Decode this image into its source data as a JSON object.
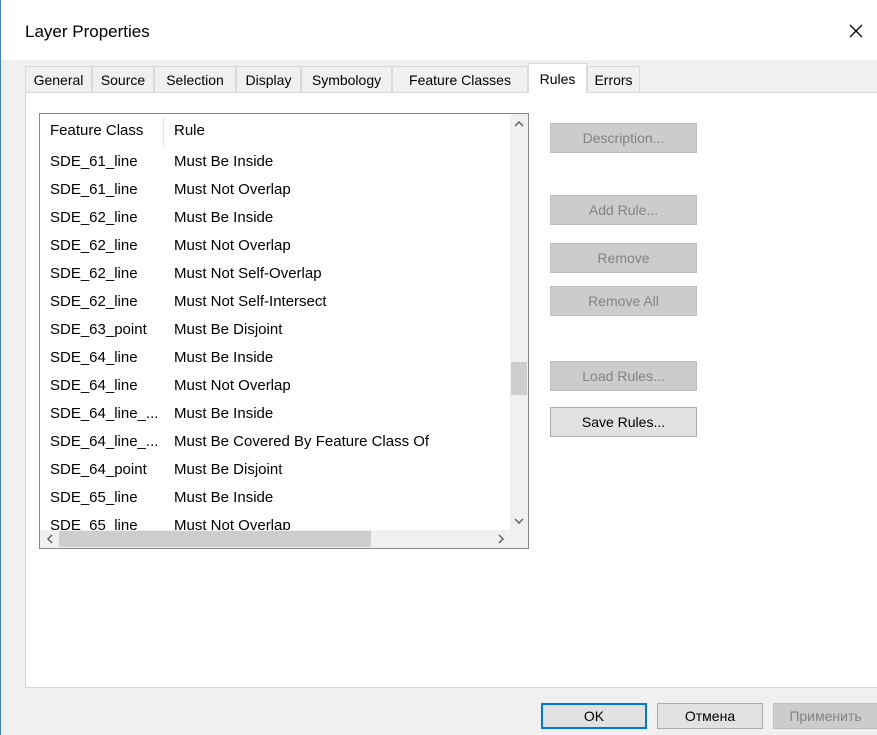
{
  "window": {
    "title": "Layer Properties"
  },
  "tabs": [
    {
      "label": "General",
      "active": false
    },
    {
      "label": "Source",
      "active": false
    },
    {
      "label": "Selection",
      "active": false
    },
    {
      "label": "Display",
      "active": false
    },
    {
      "label": "Symbology",
      "active": false
    },
    {
      "label": "Feature Classes",
      "active": false
    },
    {
      "label": "Rules",
      "active": true
    },
    {
      "label": "Errors",
      "active": false
    }
  ],
  "rules_list": {
    "columns": [
      "Feature Class",
      "Rule"
    ],
    "rows": [
      [
        "SDE_61_line",
        "Must Be Inside"
      ],
      [
        "SDE_61_line",
        "Must Not Overlap"
      ],
      [
        "SDE_62_line",
        "Must Be Inside"
      ],
      [
        "SDE_62_line",
        "Must Not Overlap"
      ],
      [
        "SDE_62_line",
        "Must Not Self-Overlap"
      ],
      [
        "SDE_62_line",
        "Must Not Self-Intersect"
      ],
      [
        "SDE_63_point",
        "Must Be Disjoint"
      ],
      [
        "SDE_64_line",
        "Must Be Inside"
      ],
      [
        "SDE_64_line",
        "Must Not Overlap"
      ],
      [
        "SDE_64_line_...",
        "Must Be Inside"
      ],
      [
        "SDE_64_line_...",
        "Must Be Covered By Feature Class Of"
      ],
      [
        "SDE_64_point",
        "Must Be Disjoint"
      ],
      [
        "SDE_65_line",
        "Must Be Inside"
      ],
      [
        "SDE_65_line",
        "Must Not Overlap"
      ]
    ]
  },
  "buttons": {
    "description": "Description...",
    "add_rule": "Add Rule...",
    "remove": "Remove",
    "remove_all": "Remove All",
    "load_rules": "Load Rules...",
    "save_rules": "Save Rules...",
    "ok": "OK",
    "cancel": "Отмена",
    "apply": "Применить"
  },
  "icons": {
    "close": "close-icon",
    "scroll_up": "chevron-up-icon",
    "scroll_down": "chevron-down-icon",
    "scroll_left": "chevron-left-icon",
    "scroll_right": "chevron-right-icon"
  },
  "colors": {
    "accent": "#0078d7",
    "window_border": "#4a7fc0",
    "disabled_text": "#838383"
  }
}
